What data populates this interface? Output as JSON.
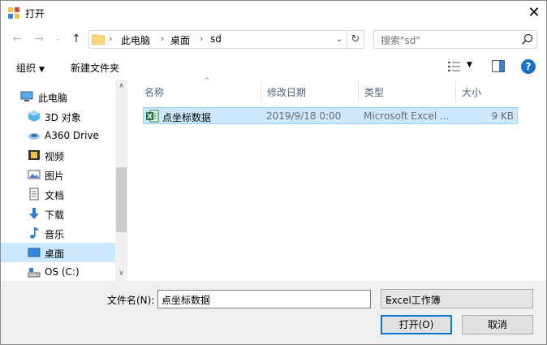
{
  "window": {
    "title": "打开",
    "close_glyph": "✕"
  },
  "nav": {
    "back_glyph": "←",
    "forward_glyph": "→",
    "recent_glyph": "⌄",
    "up_glyph": "↑",
    "breadcrumb": [
      "此电脑",
      "桌面",
      "sd"
    ],
    "sep_glyph": "›",
    "dropdown_glyph": "⌄",
    "refresh_glyph": "↻",
    "search_placeholder": "搜索\"sd\""
  },
  "toolbar": {
    "organize_label": "组织",
    "caret_glyph": "▼",
    "new_folder_label": "新建文件夹",
    "help_glyph": "?"
  },
  "sidebar": {
    "items": [
      {
        "label": "此电脑",
        "icon": "computer-icon"
      },
      {
        "label": "3D 对象",
        "icon": "3d-objects-icon"
      },
      {
        "label": "A360 Drive",
        "icon": "a360-drive-icon"
      },
      {
        "label": "视频",
        "icon": "video-icon"
      },
      {
        "label": "图片",
        "icon": "pictures-icon"
      },
      {
        "label": "文档",
        "icon": "documents-icon"
      },
      {
        "label": "下载",
        "icon": "download-icon"
      },
      {
        "label": "音乐",
        "icon": "music-icon"
      },
      {
        "label": "桌面",
        "icon": "desktop-icon",
        "selected": true
      },
      {
        "label": "OS (C:)",
        "icon": "drive-icon"
      }
    ],
    "scroll_up_glyph": "∧",
    "scroll_down_glyph": "∨"
  },
  "filelist": {
    "sort_glyph": "^",
    "columns": [
      "名称",
      "修改日期",
      "类型",
      "大小"
    ],
    "rows": [
      {
        "name": "点坐标数据",
        "modified": "2019/9/18 0:00",
        "type": "Microsoft Excel ...",
        "size": "9 KB"
      }
    ]
  },
  "bottom": {
    "filename_label": "文件名(N):",
    "filename_value": "点坐标数据",
    "dropdown_glyph": "⌄",
    "filetype_value": "Excel工作簿",
    "open_label": "打开(O)",
    "cancel_label": "取消"
  },
  "colors": {
    "selection_bg": "#cce8ff",
    "selection_border": "#99d1ff",
    "accent": "#0078d7",
    "help_blue": "#1a6fc8",
    "excel_green": "#1d7a3f"
  }
}
